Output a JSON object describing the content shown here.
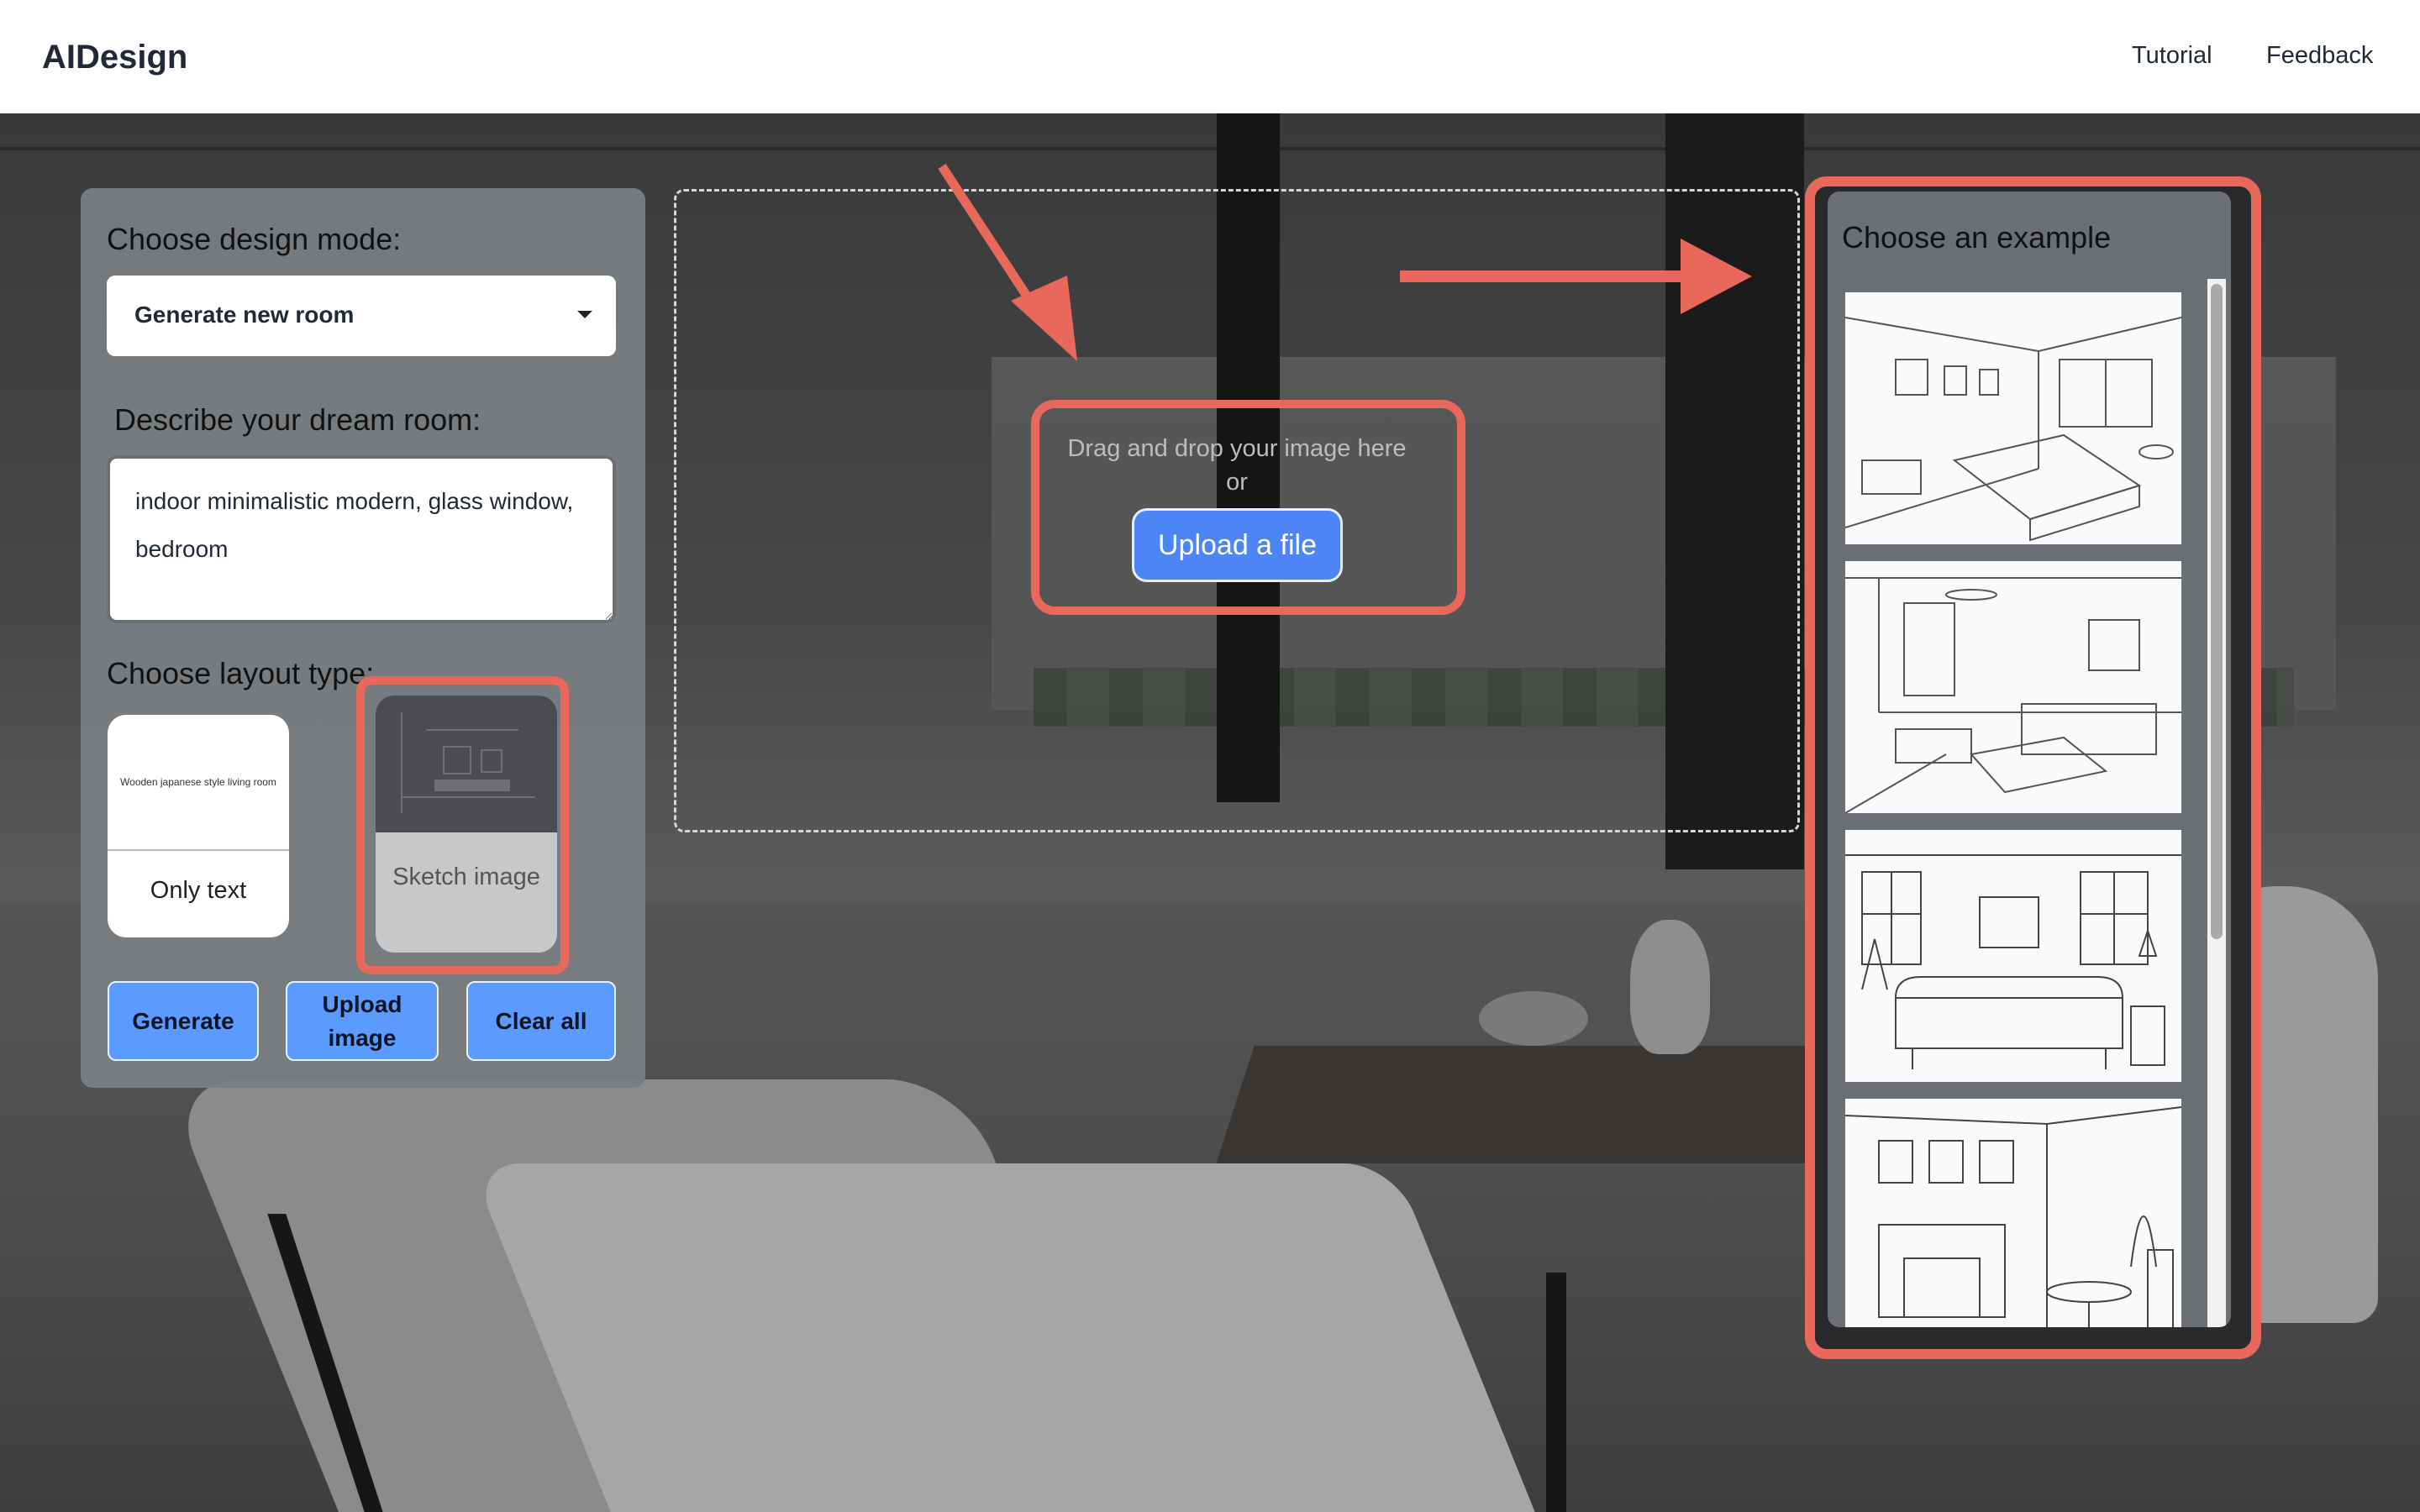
{
  "header": {
    "brand": "AIDesign",
    "nav": {
      "tutorial": "Tutorial",
      "feedback": "Feedback"
    }
  },
  "left_panel": {
    "design_mode": {
      "heading": "Choose design mode:",
      "selected": "Generate new room"
    },
    "describe": {
      "heading": "Describe your dream room:",
      "value": "indoor minimalistic modern, glass window, bedroom"
    },
    "layout": {
      "heading": "Choose layout type:",
      "options": [
        {
          "label": "Only text",
          "preview_text": "Wooden japanese style living room"
        },
        {
          "label": "Sketch image"
        }
      ]
    },
    "buttons": {
      "generate": "Generate",
      "upload": "Upload image",
      "clear": "Clear all"
    }
  },
  "dropzone": {
    "prompt": "Drag and drop your image here",
    "or": "or",
    "button": "Upload a file"
  },
  "examples": {
    "heading": "Choose an example",
    "items": [
      "bedroom-sketch",
      "living-room-sketch",
      "sofa-wall-sketch",
      "fireplace-dining-sketch"
    ]
  },
  "colors": {
    "annotation_red": "#e8695c",
    "primary_button": "#5b9bff",
    "upload_button": "#4d86f4"
  }
}
